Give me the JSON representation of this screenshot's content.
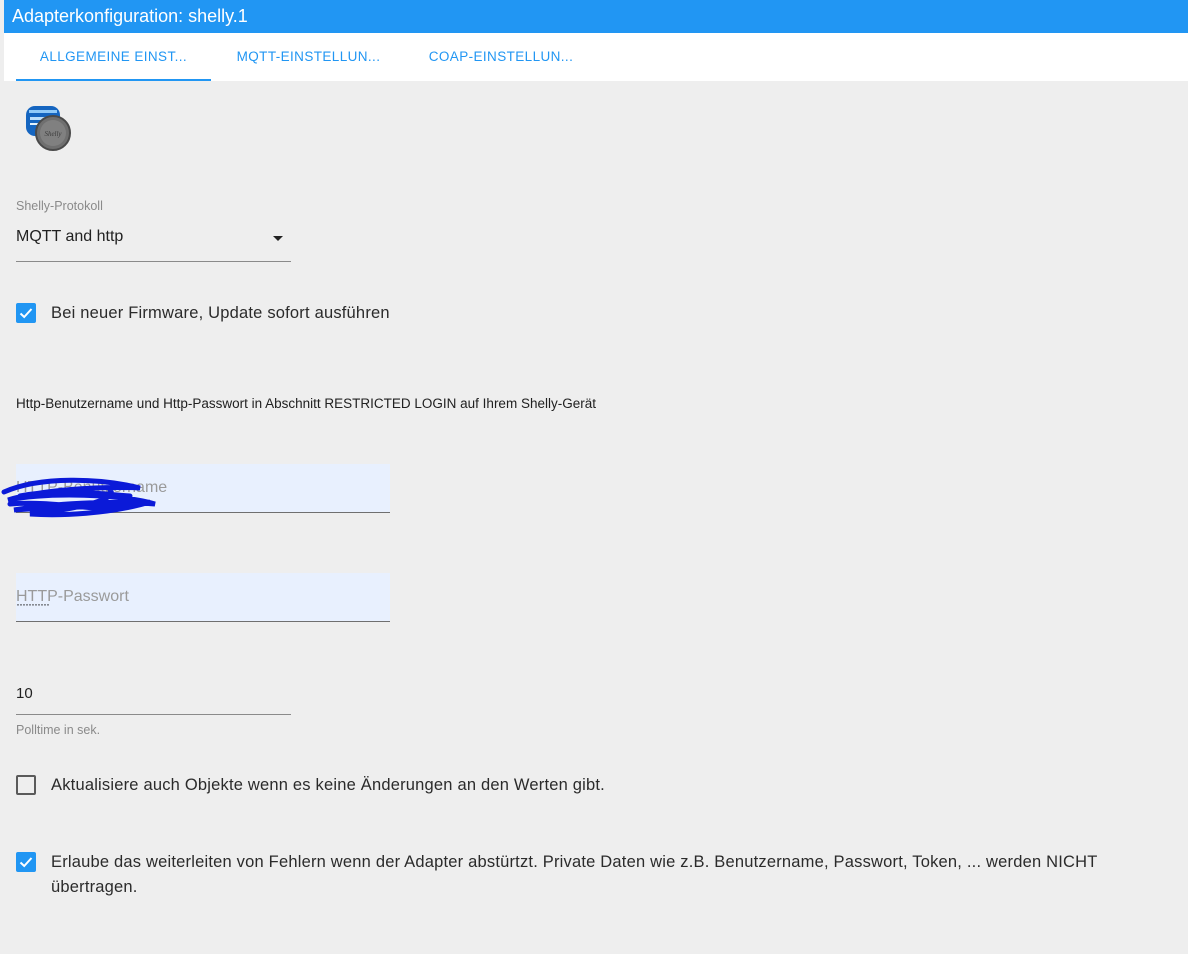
{
  "window": {
    "title": "Adapterkonfiguration: shelly.1"
  },
  "tabs": [
    {
      "label": "ALLGEMEINE EINST...",
      "active": true
    },
    {
      "label": "MQTT-EINSTELLUN...",
      "active": false
    },
    {
      "label": "COAP-EINSTELLUN...",
      "active": false
    }
  ],
  "accent_color": "#2196f3",
  "logo": {
    "icon": "shelly-logo-icon"
  },
  "protocol": {
    "label": "Shelly-Protokoll",
    "value": "MQTT and http"
  },
  "firmware_update": {
    "label": "Bei neuer Firmware, Update sofort ausführen",
    "checked": true
  },
  "http_info": "Http-Benutzername und Http-Passwort in Abschnitt RESTRICTED LOGIN auf Ihrem Shelly-Gerät",
  "http_username": {
    "placeholder": "HTTP-Benutzername"
  },
  "http_password": {
    "placeholder": "HTTP-Passwort",
    "masked_value": "···········"
  },
  "polltime": {
    "value": "10",
    "helper": "Polltime in sek."
  },
  "update_unchanged": {
    "label": "Aktualisiere auch Objekte wenn es keine Änderungen an den Werten gibt.",
    "checked": false
  },
  "error_reporting": {
    "label_line1": "Erlaube das weiterleiten von Fehlern wenn der Adapter abstürtzt. Private Daten wie z.B. Benutzername, Passwort, Token, ... werden NICHT",
    "label_line2": "übertragen.",
    "checked": true
  }
}
